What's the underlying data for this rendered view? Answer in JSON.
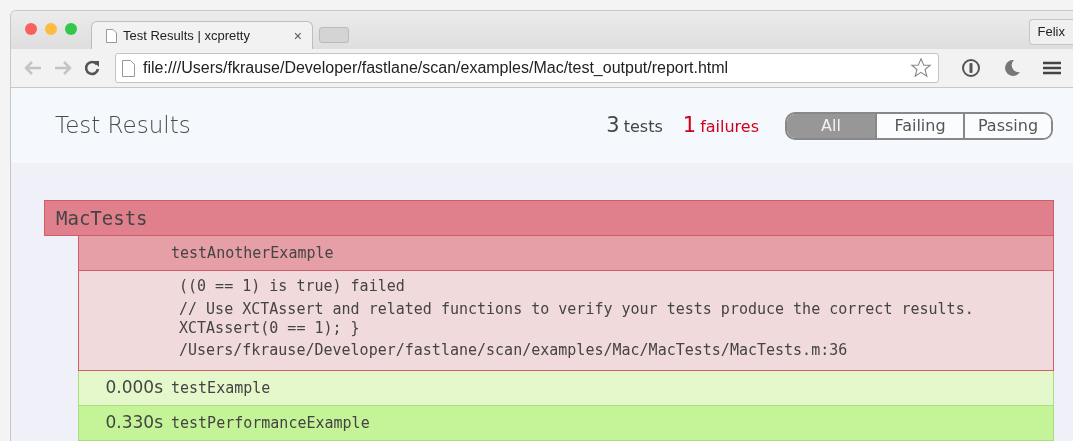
{
  "browser": {
    "tab": {
      "title": "Test Results | xcpretty",
      "close": "×"
    },
    "profile": "Felix",
    "address": "file:///Users/fkrause/Developer/fastlane/scan/examples/Mac/test_output/report.html",
    "back_disabled": true,
    "forward_disabled": true
  },
  "header": {
    "title": "Test Results",
    "tests_count": "3",
    "tests_label": "tests",
    "failures_count": "1",
    "failures_label": "failures",
    "filters": [
      {
        "label": "All",
        "selected": true
      },
      {
        "label": "Failing",
        "selected": false
      },
      {
        "label": "Passing",
        "selected": false
      }
    ]
  },
  "suites": [
    {
      "name": "MacTests",
      "failed": true,
      "tests": [
        {
          "name": "testAnotherExample",
          "failed": true,
          "failure": {
            "reason": "((0 == 1) is true) failed",
            "snippet": "// Use XCTAssert and related functions to verify your tests produce the correct results.\nXCTAssert(0 == 1); }",
            "location": "/Users/fkrause/Developer/fastlane/scan/examples/Mac/MacTests/MacTests.m:36"
          }
        },
        {
          "time": "0.000s",
          "name": "testExample",
          "failed": false
        },
        {
          "time": "0.330s",
          "name": "testPerformanceExample",
          "failed": false
        }
      ]
    }
  ]
}
